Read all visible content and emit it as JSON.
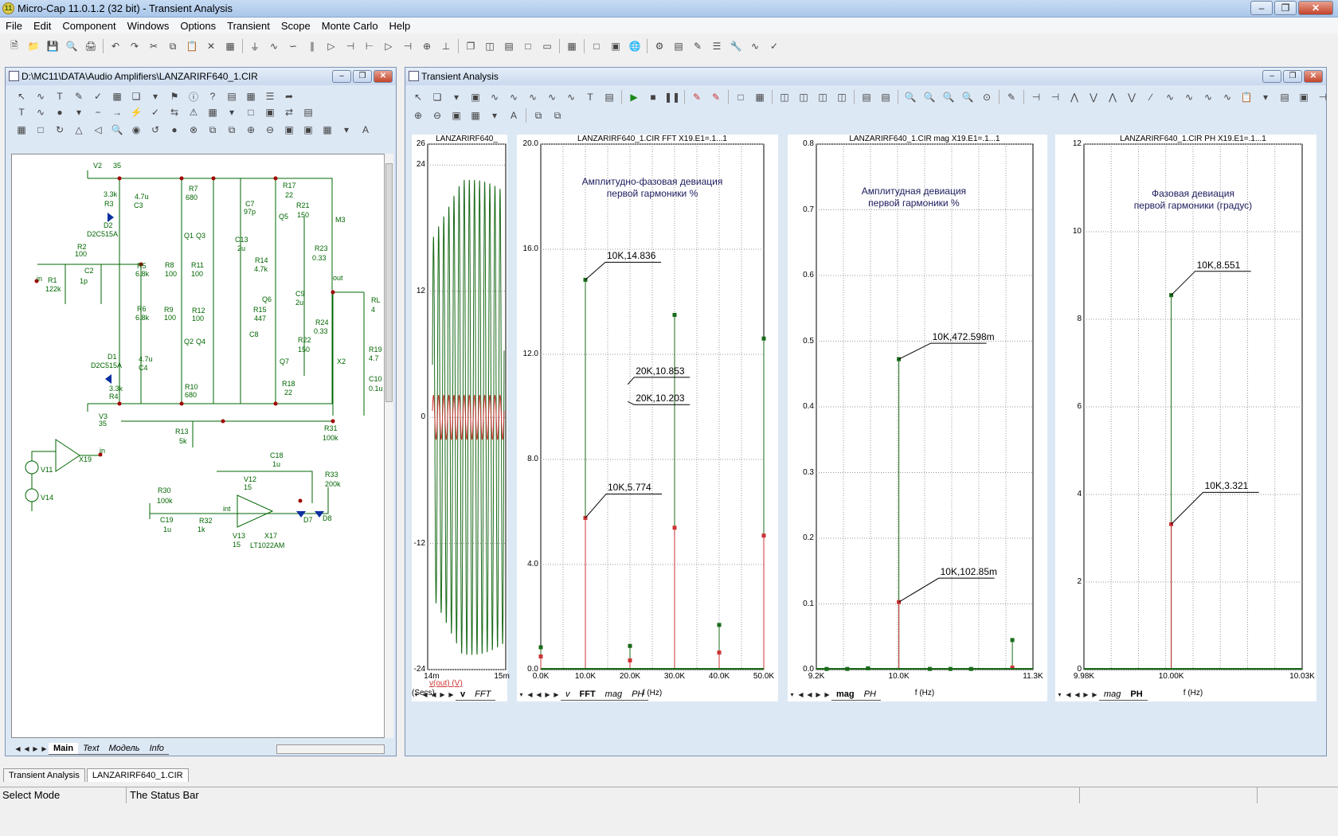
{
  "app": {
    "title": "Micro-Cap 11.0.1.2 (32 bit) - Transient Analysis",
    "icon_text": "11"
  },
  "menu": [
    "File",
    "Edit",
    "Component",
    "Windows",
    "Options",
    "Transient",
    "Scope",
    "Monte Carlo",
    "Help"
  ],
  "schematic_window": {
    "title": "D:\\MC11\\DATA\\Audio Amplifiers\\LANZARIRF640_1.CIR",
    "tabs": [
      "Main",
      "Text",
      "Модель",
      "Info"
    ],
    "active_tab": "Main",
    "labels": [
      {
        "t": "V2",
        "x": 115,
        "y": 209
      },
      {
        "t": "35",
        "x": 140,
        "y": 209
      },
      {
        "t": "R7",
        "x": 235,
        "y": 238
      },
      {
        "t": "680",
        "x": 231,
        "y": 249
      },
      {
        "t": "R17",
        "x": 353,
        "y": 234
      },
      {
        "t": "22",
        "x": 356,
        "y": 246
      },
      {
        "t": "3.3k",
        "x": 128,
        "y": 245
      },
      {
        "t": "4.7u",
        "x": 167,
        "y": 248
      },
      {
        "t": "R3",
        "x": 129,
        "y": 257
      },
      {
        "t": "C3",
        "x": 166,
        "y": 259
      },
      {
        "t": "C7",
        "x": 306,
        "y": 257
      },
      {
        "t": "97p",
        "x": 304,
        "y": 267
      },
      {
        "t": "R21",
        "x": 370,
        "y": 259
      },
      {
        "t": "150",
        "x": 371,
        "y": 271
      },
      {
        "t": "M3",
        "x": 419,
        "y": 277
      },
      {
        "t": "D2",
        "x": 128,
        "y": 284
      },
      {
        "t": "D2C515A",
        "x": 107,
        "y": 295
      },
      {
        "t": "Q1",
        "x": 229,
        "y": 297
      },
      {
        "t": "Q3",
        "x": 244,
        "y": 297
      },
      {
        "t": "Q5",
        "x": 348,
        "y": 273
      },
      {
        "t": "C13",
        "x": 293,
        "y": 302
      },
      {
        "t": "2u",
        "x": 296,
        "y": 313
      },
      {
        "t": "R2",
        "x": 95,
        "y": 311
      },
      {
        "t": "100",
        "x": 92,
        "y": 320
      },
      {
        "t": "R23",
        "x": 393,
        "y": 313
      },
      {
        "t": "0.33",
        "x": 390,
        "y": 325
      },
      {
        "t": "R14",
        "x": 318,
        "y": 328
      },
      {
        "t": "4.7k",
        "x": 317,
        "y": 339
      },
      {
        "t": "R5",
        "x": 170,
        "y": 335
      },
      {
        "t": "6.8k",
        "x": 168,
        "y": 345
      },
      {
        "t": "R8",
        "x": 205,
        "y": 334
      },
      {
        "t": "100",
        "x": 205,
        "y": 345
      },
      {
        "t": "R11",
        "x": 238,
        "y": 334
      },
      {
        "t": "100",
        "x": 238,
        "y": 345
      },
      {
        "t": "C2",
        "x": 104,
        "y": 341
      },
      {
        "t": "R1",
        "x": 58,
        "y": 353
      },
      {
        "t": "122k",
        "x": 55,
        "y": 364
      },
      {
        "t": "1p",
        "x": 98,
        "y": 354
      },
      {
        "t": "out",
        "x": 416,
        "y": 350
      },
      {
        "t": "C9",
        "x": 369,
        "y": 370
      },
      {
        "t": "2u",
        "x": 369,
        "y": 381
      },
      {
        "t": "RL",
        "x": 464,
        "y": 378
      },
      {
        "t": "4",
        "x": 464,
        "y": 390
      },
      {
        "t": "Q6",
        "x": 327,
        "y": 377
      },
      {
        "t": "R6",
        "x": 170,
        "y": 389
      },
      {
        "t": "6.8k",
        "x": 168,
        "y": 400
      },
      {
        "t": "R9",
        "x": 204,
        "y": 390
      },
      {
        "t": "100",
        "x": 204,
        "y": 400
      },
      {
        "t": "R12",
        "x": 239,
        "y": 391
      },
      {
        "t": "100",
        "x": 239,
        "y": 401
      },
      {
        "t": "R15",
        "x": 316,
        "y": 390
      },
      {
        "t": "447",
        "x": 317,
        "y": 401
      },
      {
        "t": "R24",
        "x": 394,
        "y": 406
      },
      {
        "t": "0.33",
        "x": 392,
        "y": 417
      },
      {
        "t": "C8",
        "x": 311,
        "y": 421
      },
      {
        "t": "Q2",
        "x": 229,
        "y": 430
      },
      {
        "t": "Q4",
        "x": 244,
        "y": 430
      },
      {
        "t": "R22",
        "x": 372,
        "y": 428
      },
      {
        "t": "150",
        "x": 372,
        "y": 440
      },
      {
        "t": "R19",
        "x": 461,
        "y": 440
      },
      {
        "t": "4.7",
        "x": 461,
        "y": 451
      },
      {
        "t": "D1",
        "x": 133,
        "y": 449
      },
      {
        "t": "4.7u",
        "x": 172,
        "y": 452
      },
      {
        "t": "D2C515A",
        "x": 112,
        "y": 460
      },
      {
        "t": "C4",
        "x": 172,
        "y": 463
      },
      {
        "t": "Q7",
        "x": 349,
        "y": 455
      },
      {
        "t": "X2",
        "x": 421,
        "y": 455
      },
      {
        "t": "C10",
        "x": 461,
        "y": 477
      },
      {
        "t": "0.1u",
        "x": 461,
        "y": 489
      },
      {
        "t": "R10",
        "x": 230,
        "y": 487
      },
      {
        "t": "680",
        "x": 230,
        "y": 497
      },
      {
        "t": "R18",
        "x": 352,
        "y": 483
      },
      {
        "t": "22",
        "x": 355,
        "y": 494
      },
      {
        "t": "3.3k",
        "x": 135,
        "y": 489
      },
      {
        "t": "R4",
        "x": 135,
        "y": 499
      },
      {
        "t": "V3",
        "x": 122,
        "y": 524
      },
      {
        "t": "35",
        "x": 122,
        "y": 533
      },
      {
        "t": "R31",
        "x": 405,
        "y": 539
      },
      {
        "t": "100k",
        "x": 403,
        "y": 551
      },
      {
        "t": "R13",
        "x": 218,
        "y": 543
      },
      {
        "t": "5k",
        "x": 223,
        "y": 555
      },
      {
        "t": "X19",
        "x": 97,
        "y": 578
      },
      {
        "t": "C18",
        "x": 337,
        "y": 573
      },
      {
        "t": "1u",
        "x": 340,
        "y": 584
      },
      {
        "t": "V11",
        "x": 49,
        "y": 591
      },
      {
        "t": "V12",
        "x": 304,
        "y": 603
      },
      {
        "t": "15",
        "x": 304,
        "y": 613
      },
      {
        "t": "R33",
        "x": 406,
        "y": 597
      },
      {
        "t": "200k",
        "x": 406,
        "y": 609
      },
      {
        "t": "V14",
        "x": 49,
        "y": 626
      },
      {
        "t": "R30",
        "x": 196,
        "y": 617
      },
      {
        "t": "100k",
        "x": 195,
        "y": 630
      },
      {
        "t": "int",
        "x": 278,
        "y": 640
      },
      {
        "t": "C19",
        "x": 199,
        "y": 654
      },
      {
        "t": "R32",
        "x": 248,
        "y": 655
      },
      {
        "t": "1u",
        "x": 203,
        "y": 666
      },
      {
        "t": "1k",
        "x": 246,
        "y": 666
      },
      {
        "t": "D7",
        "x": 379,
        "y": 654
      },
      {
        "t": "D8",
        "x": 403,
        "y": 652
      },
      {
        "t": "V13",
        "x": 290,
        "y": 674
      },
      {
        "t": "X17",
        "x": 330,
        "y": 674
      },
      {
        "t": "15",
        "x": 290,
        "y": 685
      },
      {
        "t": "LT1022AM",
        "x": 312,
        "y": 686
      },
      {
        "t": "in",
        "x": 44,
        "y": 351
      },
      {
        "t": "in",
        "x": 123,
        "y": 567
      }
    ]
  },
  "transient_window": {
    "title": "Transient Analysis"
  },
  "plots": [
    {
      "id": "v",
      "title": "LANZARIRF640_",
      "xticks": [
        "14m",
        "15m"
      ],
      "xlabel": "(Secs)",
      "yticks": [
        "26",
        "24",
        "12",
        "0",
        "-12",
        "-24"
      ],
      "legend": "v(out) (V)",
      "tabs": [
        "v",
        "FFT"
      ],
      "active_tab": "v"
    },
    {
      "id": "fft",
      "title": "LANZARIRF640_1.CIR FFT X19.E1=.1...1",
      "xticks": [
        "0.0K",
        "10.0K",
        "20.0K",
        "30.0K",
        "40.0K",
        "50.0K"
      ],
      "xlabel": "f (Hz)",
      "yticks": [
        "20.0",
        "16.0",
        "12.0",
        "8.0",
        "4.0",
        "0.0"
      ],
      "note": [
        "Амплитудно-фазовая девиация",
        "первой гармоники %"
      ],
      "labels": [
        "10K,14.836",
        "20K,10.853",
        "20K,10.203",
        "10K,5.774"
      ],
      "tabs": [
        "v",
        "FFT",
        "mag",
        "PH"
      ],
      "active_tab": "FFT"
    },
    {
      "id": "mag",
      "title": "LANZARIRF640_1.CIR mag X19.E1=.1...1",
      "xticks": [
        "9.2K",
        "10.0K",
        "11.3K"
      ],
      "xlabel": "f (Hz)",
      "yticks": [
        "0.8",
        "0.7",
        "0.6",
        "0.5",
        "0.4",
        "0.3",
        "0.2",
        "0.1",
        "0.0"
      ],
      "note": [
        "Амплитудная девиация",
        "первой гармоники %"
      ],
      "labels": [
        "10K,472.598m",
        "10K,102.85m"
      ],
      "tabs": [
        "mag",
        "PH"
      ],
      "active_tab": "mag"
    },
    {
      "id": "ph",
      "title": "LANZARIRF640_1.CIR PH X19.E1=.1...1",
      "xticks": [
        "9.98K",
        "10.00K",
        "10.03K"
      ],
      "xlabel": "f (Hz)",
      "yticks": [
        "12",
        "10",
        "8",
        "6",
        "4",
        "2",
        "0"
      ],
      "note": [
        "Фазовая девиация",
        "первой гармоники (градус)"
      ],
      "labels": [
        "10K,8.551",
        "10K,3.321"
      ],
      "tabs": [
        "mag",
        "PH"
      ],
      "active_tab": "PH"
    }
  ],
  "chart_data": [
    {
      "type": "line",
      "title": "LANZARIRF640_",
      "xlabel": "(Secs)",
      "ylabel": "",
      "xlim": [
        0.014,
        0.015
      ],
      "ylim": [
        -24,
        26
      ],
      "series": [
        {
          "name": "v(out) (V)",
          "color": "#1a6b1a",
          "amplitude": 22.6,
          "cycles": 14
        },
        {
          "name": "",
          "color": "#cc3333",
          "amplitude": 2.1,
          "cycles": 14
        }
      ]
    },
    {
      "type": "stem",
      "title": "LANZARIRF640_1.CIR FFT X19.E1=.1...1",
      "xlabel": "f (Hz)",
      "xlim": [
        0,
        50000
      ],
      "ylim": [
        0,
        20
      ],
      "series": [
        {
          "name": "green",
          "color": "#1a6b1a",
          "x": [
            0,
            10000,
            20000,
            30000,
            40000,
            50000
          ],
          "values": [
            0.85,
            14.836,
            0.9,
            13.5,
            1.7,
            12.6
          ]
        },
        {
          "name": "red",
          "color": "#cc3333",
          "x": [
            0,
            10000,
            20000,
            30000,
            40000,
            50000
          ],
          "values": [
            0.5,
            5.774,
            0.35,
            5.4,
            0.65,
            5.1
          ]
        }
      ]
    },
    {
      "type": "stem",
      "title": "LANZARIRF640_1.CIR mag X19.E1=.1...1",
      "xlabel": "f (Hz)",
      "xlim": [
        9200,
        11300
      ],
      "ylim": [
        0,
        0.8
      ],
      "series": [
        {
          "name": "green",
          "color": "#1a6b1a",
          "x": [
            9300,
            9500,
            9700,
            10000,
            10300,
            10500,
            10700,
            11100
          ],
          "values": [
            0.001,
            0.001,
            0.002,
            0.4726,
            0.001,
            0.001,
            0.001,
            0.045
          ]
        },
        {
          "name": "red",
          "color": "#cc3333",
          "x": [
            10000,
            11100
          ],
          "values": [
            0.10285,
            0.003
          ]
        }
      ]
    },
    {
      "type": "stem",
      "title": "LANZARIRF640_1.CIR PH X19.E1=.1...1",
      "xlabel": "f (Hz)",
      "xlim": [
        9980,
        10030
      ],
      "ylim": [
        0,
        12
      ],
      "series": [
        {
          "name": "green",
          "color": "#1a6b1a",
          "x": [
            10000
          ],
          "values": [
            8.551
          ]
        },
        {
          "name": "red",
          "color": "#cc3333",
          "x": [
            10000
          ],
          "values": [
            3.321
          ]
        }
      ]
    }
  ],
  "bottom_tabs": [
    "Transient Analysis",
    "LANZARIRF640_1.CIR"
  ],
  "status": {
    "mode": "Select Mode",
    "message": "The Status Bar"
  },
  "icons": [
    "new-icon",
    "open-icon",
    "save-icon",
    "print-icon",
    "undo-icon",
    "redo-icon",
    "cut-icon",
    "copy-icon",
    "paste-icon",
    "delete-icon",
    "run-icon",
    "stop-icon",
    "zoom-in-icon",
    "zoom-out-icon"
  ]
}
